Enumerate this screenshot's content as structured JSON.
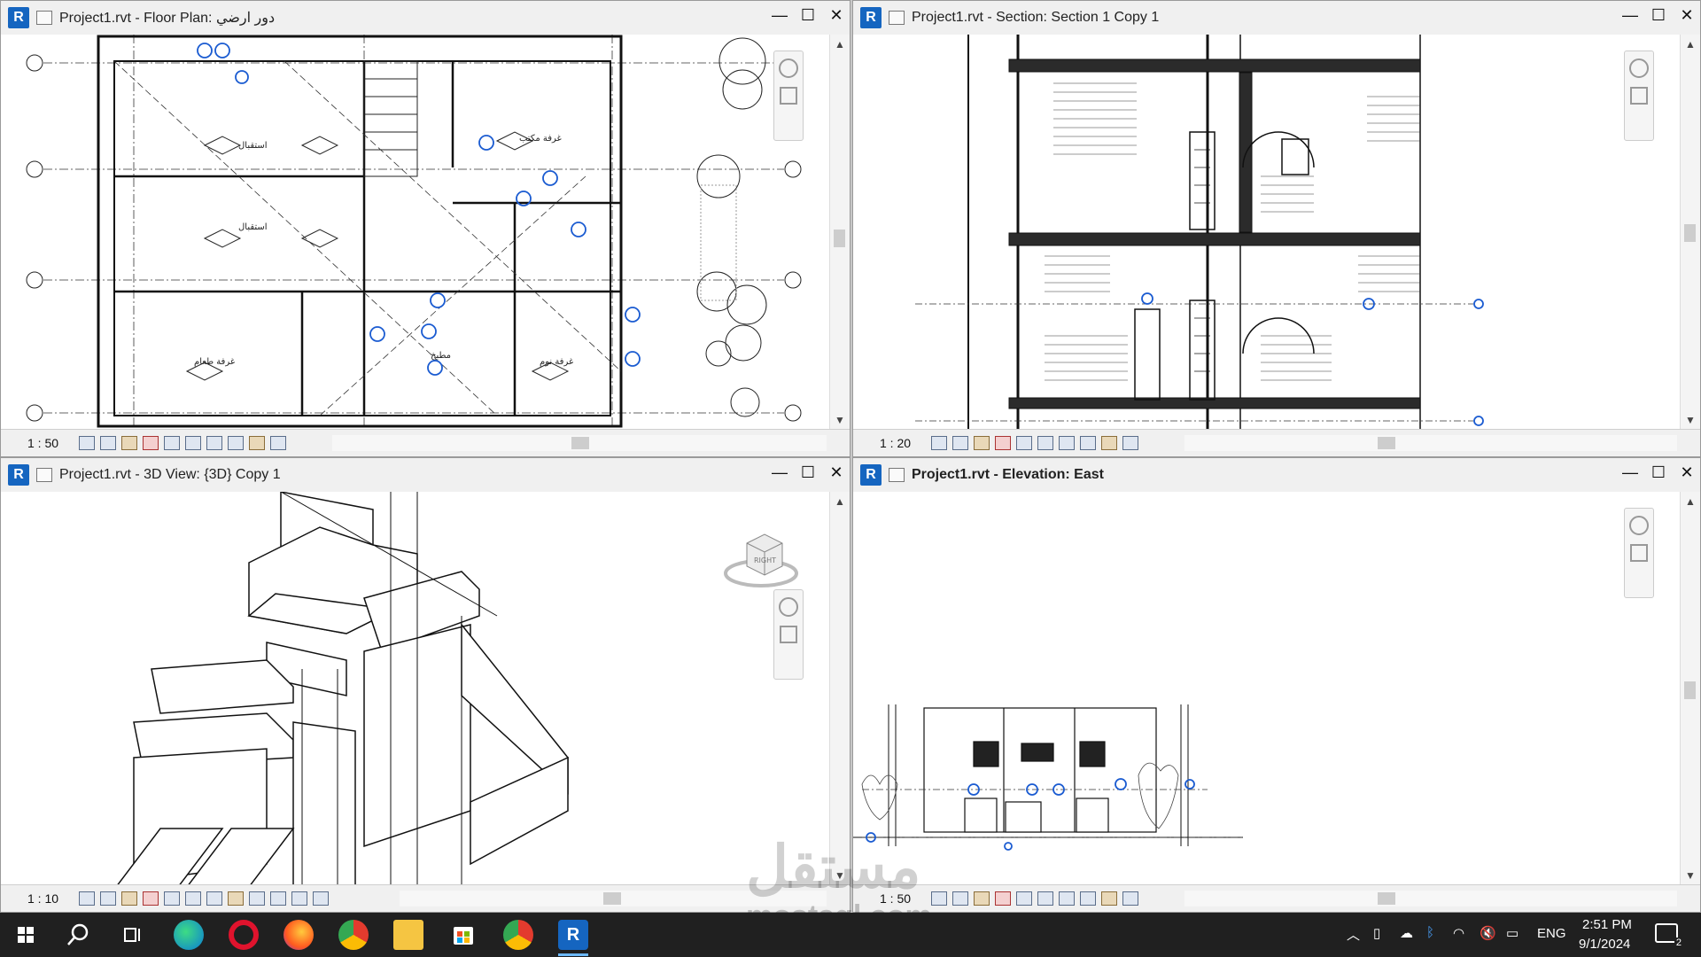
{
  "windows": {
    "plan": {
      "title": "Project1.rvt - Floor Plan: دور ارضي",
      "scale": "1 : 50"
    },
    "section": {
      "title": "Project1.rvt - Section: Section 1 Copy 1",
      "scale": "1 : 20"
    },
    "view3d": {
      "title": "Project1.rvt - 3D View: {3D} Copy 1",
      "scale": "1 : 10"
    },
    "elevation": {
      "title": "Project1.rvt - Elevation: East",
      "scale": "1 : 50"
    }
  },
  "window_controls": {
    "minimize": "—",
    "maximize": "☐",
    "close": "✕"
  },
  "plan_labels": {
    "room1": "استقبال",
    "room2": "استقبال",
    "room3": "غرفة طعام",
    "room4": "غرفة نوم",
    "room5": "مطبخ",
    "room6": "غرفة مكتب"
  },
  "viewcube": {
    "face": "RIGHT"
  },
  "taskbar": {
    "items": [
      "start",
      "search",
      "task-view",
      "edge",
      "opera",
      "firefox",
      "chrome",
      "file-explorer",
      "store",
      "chrome-profile",
      "revit"
    ],
    "tray": {
      "language": "ENG",
      "time": "2:51 PM",
      "date": "9/1/2024",
      "notifications": "2"
    }
  },
  "watermark": {
    "text": "مستقل",
    "subtext": "mostaql.com"
  },
  "colors": {
    "accent": "#1565c0",
    "taskbar": "#202020",
    "select_blue": "#1a5bd1"
  }
}
